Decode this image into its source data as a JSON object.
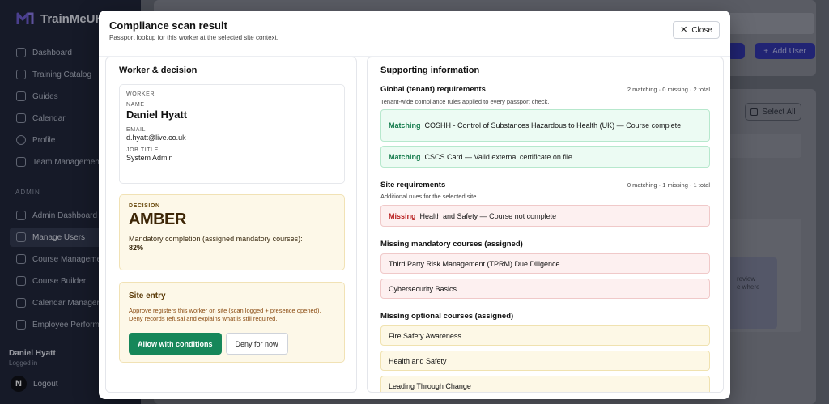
{
  "app": {
    "name": "TrainMeUK",
    "sidebar": {
      "items": [
        {
          "label": "Dashboard",
          "icon": "home-icon"
        },
        {
          "label": "Training Catalog",
          "icon": "book-icon"
        },
        {
          "label": "Guides",
          "icon": "document-icon"
        },
        {
          "label": "Calendar",
          "icon": "calendar-icon"
        },
        {
          "label": "Profile",
          "icon": "user-icon"
        },
        {
          "label": "Team Management",
          "icon": "users-icon"
        }
      ],
      "admin_section": "ADMIN",
      "admin_items": [
        {
          "label": "Admin Dashboard",
          "icon": "chart-icon"
        },
        {
          "label": "Manage Users",
          "icon": "users-icon"
        },
        {
          "label": "Course Management",
          "icon": "book-icon"
        },
        {
          "label": "Course Builder",
          "icon": "build-icon"
        },
        {
          "label": "Calendar Management",
          "icon": "calendar-icon"
        },
        {
          "label": "Employee Performance",
          "icon": "chart-icon"
        }
      ],
      "user_name": "Daniel Hyatt",
      "user_status": "Logged in",
      "logout_label": "Logout",
      "avatar_letter": "N"
    },
    "background": {
      "add_user_label": "Add User",
      "select_all_label": "Select All",
      "hint_text": "review\ne where"
    }
  },
  "modal": {
    "title": "Compliance scan result",
    "subtitle": "Passport lookup for this worker at the selected site context.",
    "close_label": "Close",
    "left": {
      "title": "Worker & decision",
      "worker_label": "WORKER",
      "name_label": "NAME",
      "name": "Daniel Hyatt",
      "email_label": "EMAIL",
      "email": "d.hyatt@live.co.uk",
      "job_title_label": "JOB TITLE",
      "job_title": "System Admin",
      "decision_label": "DECISION",
      "decision": "AMBER",
      "completion_text": "Mandatory completion (assigned mandatory courses):",
      "completion_pct": "82%",
      "site_entry_title": "Site entry",
      "site_entry_text": "Approve registers this worker on site (scan logged + presence opened). Deny records refusal and explains what is still required.",
      "allow_label": "Allow with conditions",
      "deny_label": "Deny for now"
    },
    "right": {
      "title": "Supporting information",
      "global": {
        "title": "Global (tenant) requirements",
        "subtitle": "Tenant-wide compliance rules applied to every passport check.",
        "stats": "2 matching · 0 missing · 2 total",
        "items": [
          {
            "status": "Matching",
            "name": "COSHH - Control of Substances Hazardous to Health (UK)",
            "note": " — Course complete"
          },
          {
            "status": "Matching",
            "name": "CSCS Card",
            "note": " — Valid external certificate on file"
          }
        ]
      },
      "site": {
        "title": "Site requirements",
        "subtitle": "Additional rules for the selected site.",
        "stats": "0 matching · 1 missing · 1 total",
        "items": [
          {
            "status": "Missing",
            "name": "Health and Safety",
            "note": " — Course not complete"
          }
        ]
      },
      "missing_mandatory": {
        "title": "Missing mandatory courses (assigned)",
        "items": [
          "Third Party Risk Management (TPRM) Due Diligence",
          "Cybersecurity Basics"
        ]
      },
      "missing_optional": {
        "title": "Missing optional courses (assigned)",
        "items": [
          "Fire Safety Awareness",
          "Health and Safety",
          "Leading Through Change"
        ]
      }
    }
  },
  "colors": {
    "accent": "#3b3fd8",
    "success": "#16875a",
    "danger": "#b81f1f",
    "amber": "#3d2606"
  }
}
